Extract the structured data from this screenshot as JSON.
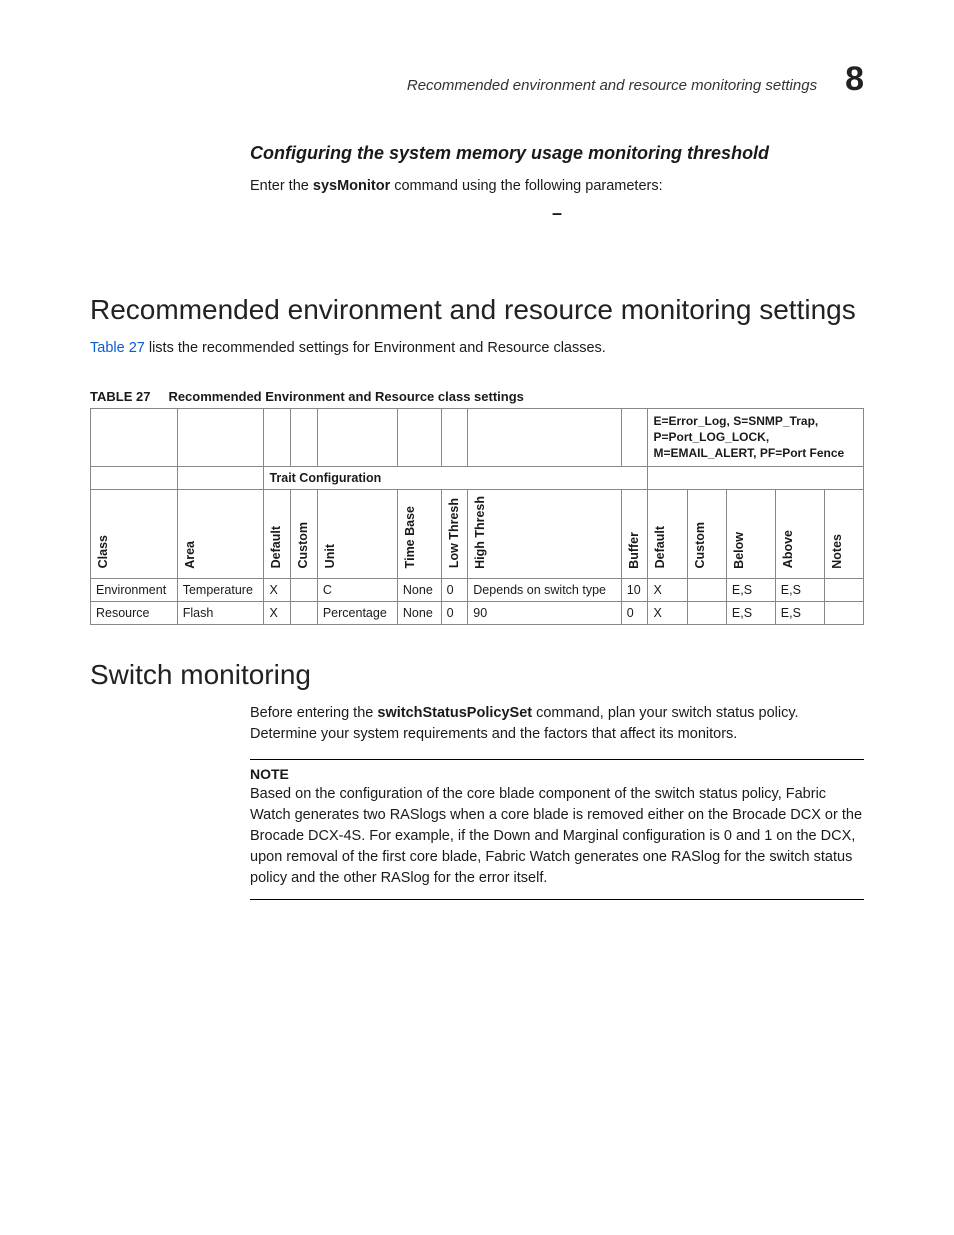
{
  "header": {
    "breadcrumb": "Recommended environment and resource monitoring settings",
    "chapter": "8"
  },
  "sub": {
    "title": "Configuring the system memory usage monitoring threshold",
    "cmd_prefix": "Enter the ",
    "cmd_bold": "sysMonitor",
    "cmd_suffix": " command using the following parameters:",
    "dash": "–"
  },
  "section1": {
    "heading": "Recommended environment and resource monitoring settings",
    "lead_link": "Table 27",
    "lead_rest": " lists the recommended settings for Environment and Resource classes.",
    "table_caption_num": "TABLE 27",
    "table_caption_text": "Recommended Environment and Resource class settings",
    "legend": {
      "l1a": "E",
      "l1b": "=Error_Log, ",
      "l1c": "S",
      "l1d": "=SNMP_Trap,",
      "l2a": "P",
      "l2b": "=Port_LOG_LOCK,",
      "l3a": "M",
      "l3b": "=EMAIL_ALERT, ",
      "l3c": "PF",
      "l3d": "=Port Fence"
    },
    "trait": "Trait Configuration",
    "cols": {
      "class": "Class",
      "area": "Area",
      "default": "Default",
      "custom": "Custom",
      "unit": "Unit",
      "timebase": "Time Base",
      "lowthresh": "Low Thresh",
      "highthresh": "High Thresh",
      "buffer": "Buffer",
      "a_default": "Default",
      "a_custom": "Custom",
      "below": "Below",
      "above": "Above",
      "notes": "Notes"
    },
    "rows": [
      {
        "class": "Environment",
        "area": "Temperature",
        "default": "X",
        "custom": "",
        "unit": "C",
        "timebase": "None",
        "lowthresh": "0",
        "highthresh": "Depends on switch type",
        "buffer": "10",
        "a_default": "X",
        "a_custom": "",
        "below": "E,S",
        "above": "E,S",
        "notes": ""
      },
      {
        "class": "Resource",
        "area": "Flash",
        "default": "X",
        "custom": "",
        "unit": "Percentage",
        "timebase": "None",
        "lowthresh": "0",
        "highthresh": "90",
        "buffer": "0",
        "a_default": "X",
        "a_custom": "",
        "below": "E,S",
        "above": "E,S",
        "notes": ""
      }
    ]
  },
  "section2": {
    "heading": "Switch monitoring",
    "p1a": "Before entering the ",
    "p1cmd": "switchStatusPolicySet",
    "p1b": " command, plan your switch status policy. Determine your system requirements and the factors that affect its monitors.",
    "note_label": "NOTE",
    "note_body": "Based on the configuration of the core blade component of the switch status policy, Fabric Watch generates two RASlogs when a core blade is removed either on the Brocade DCX or the Brocade DCX-4S. For example, if the Down and Marginal configuration is 0 and 1 on the DCX, upon removal of the first core blade, Fabric Watch generates one RASlog for the switch status policy and the other RASlog for the error itself."
  }
}
